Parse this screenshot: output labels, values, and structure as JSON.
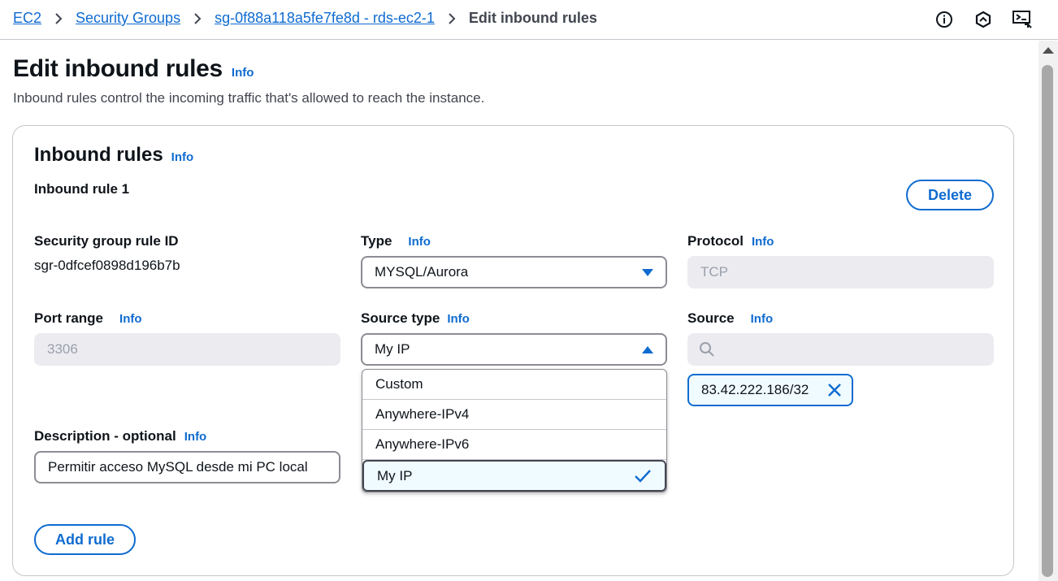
{
  "breadcrumb": {
    "items": [
      "EC2",
      "Security Groups",
      "sg-0f88a118a5fe7fe8d - rds-ec2-1"
    ],
    "current": "Edit inbound rules"
  },
  "top_icons": [
    "info-circle-icon",
    "notifications-icon",
    "feedback-icon"
  ],
  "page": {
    "title": "Edit inbound rules",
    "info": "Info",
    "description": "Inbound rules control the incoming traffic that's allowed to reach the instance."
  },
  "section": {
    "title": "Inbound rules",
    "info": "Info",
    "rule_title": "Inbound rule 1",
    "delete_label": "Delete",
    "add_rule_label": "Add rule"
  },
  "fields": {
    "rule_id": {
      "label": "Security group rule ID",
      "value": "sgr-0dfcef0898d196b7b"
    },
    "type": {
      "label": "Type",
      "info": "Info",
      "value": "MYSQL/Aurora"
    },
    "protocol": {
      "label": "Protocol",
      "info": "Info",
      "value": "TCP"
    },
    "port_range": {
      "label": "Port range",
      "info": "Info",
      "value": "3306"
    },
    "source_type": {
      "label": "Source type",
      "info": "Info",
      "value": "My IP",
      "options": [
        "Custom",
        "Anywhere-IPv4",
        "Anywhere-IPv6",
        "My IP"
      ],
      "selected_option": "My IP"
    },
    "source": {
      "label": "Source",
      "info": "Info",
      "search_value": "",
      "token": "83.42.222.186/32"
    },
    "description": {
      "label": "Description - optional",
      "info": "Info",
      "value": "Permitir acceso MySQL desde mi PC local"
    }
  },
  "colors": {
    "link": "#0f6bd0",
    "text": "#0f141a",
    "muted": "#424650",
    "border": "#8c8c94",
    "disabled_bg": "#ebebf0",
    "selected_bg": "#f0fbff"
  }
}
